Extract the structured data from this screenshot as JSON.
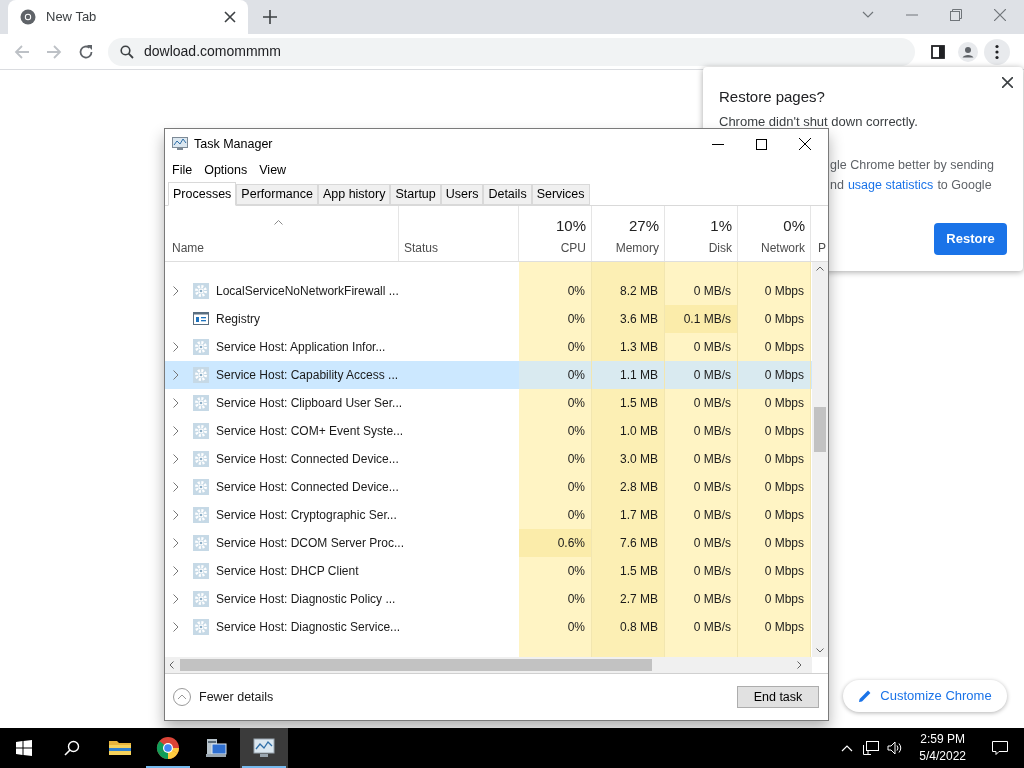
{
  "browser": {
    "tab": {
      "title": "New Tab"
    },
    "address": "dowload.comommmm"
  },
  "restore_popup": {
    "title": "Restore pages?",
    "message": "Chrome didn't shut down correctly.",
    "line_1": "gle Chrome better by sending",
    "line_2": {
      "before": "nd",
      "link": "usage statistics",
      "after": "to Google"
    },
    "button": "Restore"
  },
  "customize_button": "Customize Chrome",
  "task_manager": {
    "title": "Task Manager",
    "menu": [
      "File",
      "Options",
      "View"
    ],
    "tabs": [
      {
        "label": "Processes",
        "selected": true
      },
      {
        "label": "Performance",
        "selected": false
      },
      {
        "label": "App history",
        "selected": false
      },
      {
        "label": "Startup",
        "selected": false
      },
      {
        "label": "Users",
        "selected": false
      },
      {
        "label": "Details",
        "selected": false
      },
      {
        "label": "Services",
        "selected": false
      }
    ],
    "name_header": "Name",
    "status_header": "Status",
    "columns": [
      {
        "percent": "10%",
        "label": "CPU"
      },
      {
        "percent": "27%",
        "label": "Memory"
      },
      {
        "percent": "1%",
        "label": "Disk"
      },
      {
        "percent": "0%",
        "label": "Network"
      }
    ],
    "column_7": "P",
    "rows": [
      {
        "name": "LocalServiceNoNetworkFirewall ...",
        "expandable": true,
        "kind": "gear",
        "selected": false,
        "cells": [
          {
            "text": "0%",
            "color": "#fff4c4"
          },
          {
            "text": "8.2 MB",
            "color": "#fcefb4"
          },
          {
            "text": "0 MB/s",
            "color": "#fff4c4"
          },
          {
            "text": "0 Mbps",
            "color": "#fff4c4"
          }
        ]
      },
      {
        "name": "Registry",
        "expandable": false,
        "kind": "window",
        "selected": false,
        "cells": [
          {
            "text": "0%",
            "color": "#fff4c4"
          },
          {
            "text": "3.6 MB",
            "color": "#fcefb4"
          },
          {
            "text": "0.1 MB/s",
            "color": "#fbecaa"
          },
          {
            "text": "0 Mbps",
            "color": "#fff4c4"
          }
        ]
      },
      {
        "name": "Service Host: Application Infor...",
        "expandable": true,
        "kind": "gear",
        "selected": false,
        "cells": [
          {
            "text": "0%",
            "color": "#fff4c4"
          },
          {
            "text": "1.3 MB",
            "color": "#fcefb4"
          },
          {
            "text": "0 MB/s",
            "color": "#fff4c4"
          },
          {
            "text": "0 Mbps",
            "color": "#fff4c4"
          }
        ]
      },
      {
        "name": "Service Host: Capability Access ...",
        "expandable": true,
        "kind": "gear",
        "selected": true,
        "cells": [
          {
            "text": "0%",
            "color": "#d9eaf0"
          },
          {
            "text": "1.1 MB",
            "color": "#d9eaf0"
          },
          {
            "text": "0 MB/s",
            "color": "#d9eaf0"
          },
          {
            "text": "0 Mbps",
            "color": "#d9eaf0"
          }
        ]
      },
      {
        "name": "Service Host: Clipboard User Ser...",
        "expandable": true,
        "kind": "gear",
        "selected": false,
        "cells": [
          {
            "text": "0%",
            "color": "#fff4c4"
          },
          {
            "text": "1.5 MB",
            "color": "#fcefb4"
          },
          {
            "text": "0 MB/s",
            "color": "#fff4c4"
          },
          {
            "text": "0 Mbps",
            "color": "#fff4c4"
          }
        ]
      },
      {
        "name": "Service Host: COM+ Event Syste...",
        "expandable": true,
        "kind": "gear",
        "selected": false,
        "cells": [
          {
            "text": "0%",
            "color": "#fff4c4"
          },
          {
            "text": "1.0 MB",
            "color": "#fcefb4"
          },
          {
            "text": "0 MB/s",
            "color": "#fff4c4"
          },
          {
            "text": "0 Mbps",
            "color": "#fff4c4"
          }
        ]
      },
      {
        "name": "Service Host: Connected Device...",
        "expandable": true,
        "kind": "gear",
        "selected": false,
        "cells": [
          {
            "text": "0%",
            "color": "#fff4c4"
          },
          {
            "text": "3.0 MB",
            "color": "#fcefb4"
          },
          {
            "text": "0 MB/s",
            "color": "#fff4c4"
          },
          {
            "text": "0 Mbps",
            "color": "#fff4c4"
          }
        ]
      },
      {
        "name": "Service Host: Connected Device...",
        "expandable": true,
        "kind": "gear",
        "selected": false,
        "cells": [
          {
            "text": "0%",
            "color": "#fff4c4"
          },
          {
            "text": "2.8 MB",
            "color": "#fcefb4"
          },
          {
            "text": "0 MB/s",
            "color": "#fff4c4"
          },
          {
            "text": "0 Mbps",
            "color": "#fff4c4"
          }
        ]
      },
      {
        "name": "Service Host: Cryptographic Ser...",
        "expandable": true,
        "kind": "gear",
        "selected": false,
        "cells": [
          {
            "text": "0%",
            "color": "#fff4c4"
          },
          {
            "text": "1.7 MB",
            "color": "#fcefb4"
          },
          {
            "text": "0 MB/s",
            "color": "#fff4c4"
          },
          {
            "text": "0 Mbps",
            "color": "#fff4c4"
          }
        ]
      },
      {
        "name": "Service Host: DCOM Server Proc...",
        "expandable": true,
        "kind": "gear",
        "selected": false,
        "cells": [
          {
            "text": "0.6%",
            "color": "#fbecaa"
          },
          {
            "text": "7.6 MB",
            "color": "#fcefb4"
          },
          {
            "text": "0 MB/s",
            "color": "#fff4c4"
          },
          {
            "text": "0 Mbps",
            "color": "#fff4c4"
          }
        ]
      },
      {
        "name": "Service Host: DHCP Client",
        "expandable": true,
        "kind": "gear",
        "selected": false,
        "cells": [
          {
            "text": "0%",
            "color": "#fff4c4"
          },
          {
            "text": "1.5 MB",
            "color": "#fcefb4"
          },
          {
            "text": "0 MB/s",
            "color": "#fff4c4"
          },
          {
            "text": "0 Mbps",
            "color": "#fff4c4"
          }
        ]
      },
      {
        "name": "Service Host: Diagnostic Policy ...",
        "expandable": true,
        "kind": "gear",
        "selected": false,
        "cells": [
          {
            "text": "0%",
            "color": "#fff4c4"
          },
          {
            "text": "2.7 MB",
            "color": "#fcefb4"
          },
          {
            "text": "0 MB/s",
            "color": "#fff4c4"
          },
          {
            "text": "0 Mbps",
            "color": "#fff4c4"
          }
        ]
      },
      {
        "name": "Service Host: Diagnostic Service...",
        "expandable": true,
        "kind": "gear",
        "selected": false,
        "cells": [
          {
            "text": "0%",
            "color": "#fff4c4"
          },
          {
            "text": "0.8 MB",
            "color": "#fcefb4"
          },
          {
            "text": "0 MB/s",
            "color": "#fff4c4"
          },
          {
            "text": "0 Mbps",
            "color": "#fff4c4"
          }
        ]
      }
    ],
    "footer": {
      "fewer_details": "Fewer details",
      "end_task": "End task"
    }
  },
  "taskbar": {
    "apps": [
      {
        "kind": "explorer",
        "running": false,
        "selected": false
      },
      {
        "kind": "chrome",
        "running": true,
        "selected": false
      },
      {
        "kind": "server-manager",
        "running": false,
        "selected": false
      },
      {
        "kind": "task-manager",
        "running": true,
        "selected": true
      }
    ],
    "time": "2:59 PM",
    "date": "5/4/2022"
  }
}
